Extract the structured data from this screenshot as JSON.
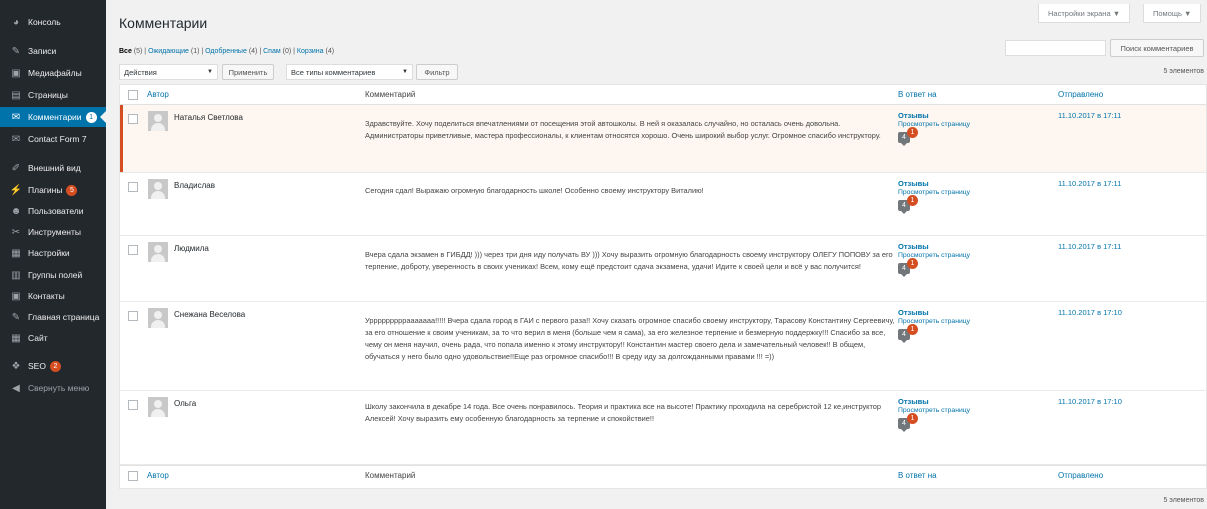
{
  "sidebar": {
    "items": [
      {
        "icon": "dashboard-icon",
        "glyph": "◕",
        "label": "Консоль"
      },
      {
        "icon": "pin-icon",
        "glyph": "✎",
        "label": "Записи"
      },
      {
        "icon": "media-icon",
        "glyph": "▣",
        "label": "Медиафайлы"
      },
      {
        "icon": "pages-icon",
        "glyph": "▤",
        "label": "Страницы"
      },
      {
        "icon": "comments-icon",
        "glyph": "✉",
        "label": "Комментарии",
        "badge": "1"
      },
      {
        "icon": "mail-icon",
        "glyph": "✉",
        "label": "Contact Form 7"
      },
      {
        "icon": "appearance-icon",
        "glyph": "✐",
        "label": "Внешний вид"
      },
      {
        "icon": "plugins-icon",
        "glyph": "⚡",
        "label": "Плагины",
        "badge": "5"
      },
      {
        "icon": "users-icon",
        "glyph": "☻",
        "label": "Пользователи"
      },
      {
        "icon": "tools-icon",
        "glyph": "✂",
        "label": "Инструменты"
      },
      {
        "icon": "settings-icon",
        "glyph": "▦",
        "label": "Настройки"
      },
      {
        "icon": "field-groups-icon",
        "glyph": "▥",
        "label": "Группы полей"
      },
      {
        "icon": "contacts-icon",
        "glyph": "▣",
        "label": "Контакты"
      },
      {
        "icon": "home-page-icon",
        "glyph": "✎",
        "label": "Главная страница"
      },
      {
        "icon": "site-icon",
        "glyph": "▦",
        "label": "Сайт"
      },
      {
        "icon": "seo-icon",
        "glyph": "❖",
        "label": "SEO",
        "badge": "2"
      },
      {
        "icon": "collapse-icon",
        "glyph": "◀",
        "label": "Свернуть меню"
      }
    ]
  },
  "header": {
    "title": "Комментарии",
    "screen_options": "Настройки экрана ▼",
    "help": "Помощь ▼"
  },
  "filters": {
    "all": "Все",
    "all_count": "(5)",
    "pending": "Ожидающие",
    "pending_count": "(1)",
    "approved": "Одобренные",
    "approved_count": "(4)",
    "spam": "Спам",
    "spam_count": "(0)",
    "trash": "Корзина",
    "trash_count": "(4)"
  },
  "search": {
    "button": "Поиск комментариев"
  },
  "toolbar": {
    "bulk_action": "Действия",
    "apply": "Применить",
    "comment_type": "Все типы комментариев",
    "filter": "Фильтр",
    "items_count": "5 элементов"
  },
  "columns": {
    "author": "Автор",
    "comment": "Комментарий",
    "in_response_to": "В ответ на",
    "submitted": "Отправлено"
  },
  "comments": [
    {
      "author": "Наталья Светлова",
      "text": "Здравствуйте. Хочу поделиться впечатлениями от посещения этой автошколы. В ней я оказалась случайно, но осталась очень довольна. Администраторы приветливые, мастера профессионалы, к клиентам относятся хорошо. Очень широкий выбор услуг. Огромное спасибо инструктору.",
      "post": "Отзывы",
      "view": "Просмотреть страницу",
      "count": "4",
      "pending": "1",
      "date": "11.10.2017 в 17:11",
      "status": "unapproved"
    },
    {
      "author": "Владислав",
      "text": "Сегодня сдал! Выражаю огромную благодарность школе! Особенно своему инструктору Виталию!",
      "post": "Отзывы",
      "view": "Просмотреть страницу",
      "count": "4",
      "pending": "1",
      "date": "11.10.2017 в 17:11",
      "status": "approved"
    },
    {
      "author": "Людмила",
      "text": "Вчера сдала экзамен в ГИБДД! ))) через три дня иду получать ВУ ))) Хочу выразить огромную благодарность своему инструктору ОЛЕГУ ПОПОВУ за его терпение, доброту, уверенность в своих учениках! Всем, кому ещё предстоит сдача экзамена, удачи! Идите к своей цели и всё у вас получится!",
      "post": "Отзывы",
      "view": "Просмотреть страницу",
      "count": "4",
      "pending": "1",
      "date": "11.10.2017 в 17:11",
      "status": "approved"
    },
    {
      "author": "Снежана Веселова",
      "text": "Урррррррррааааааа!!!!! Вчера сдала город в ГАИ с первого раза!! Хочу сказать огромное спасибо своему инструктору, Тарасову Константину Сергеевичу, за его отношение к своим ученикам, за то что верил в меня (больше чем я сама), за его железное терпение и безмерную поддержку!!! Спасибо за все, чему он меня научил, очень рада, что попала именно к этому инструктору!! Константин мастер своего дела и замечательный человек!! В общем, обучаться у него было одно удовольствие!!Еще раз огромное спасибо!!! В среду иду за долгожданными правами !!! =))",
      "post": "Отзывы",
      "view": "Просмотреть страницу",
      "count": "4",
      "pending": "1",
      "date": "11.10.2017 в 17:10",
      "status": "approved"
    },
    {
      "author": "Ольга",
      "text": "Школу закончила в декабре 14 года. Все очень понравилось. Теория и практика все на высоте! Практику проходила на серебристой 12 ке,инструктор Алексей! Хочу выразить ему особенную благодарность за терпение и спокойствие!!",
      "post": "Отзывы",
      "view": "Просмотреть страницу",
      "count": "4",
      "pending": "1",
      "date": "11.10.2017 в 17:10",
      "status": "approved"
    }
  ]
}
